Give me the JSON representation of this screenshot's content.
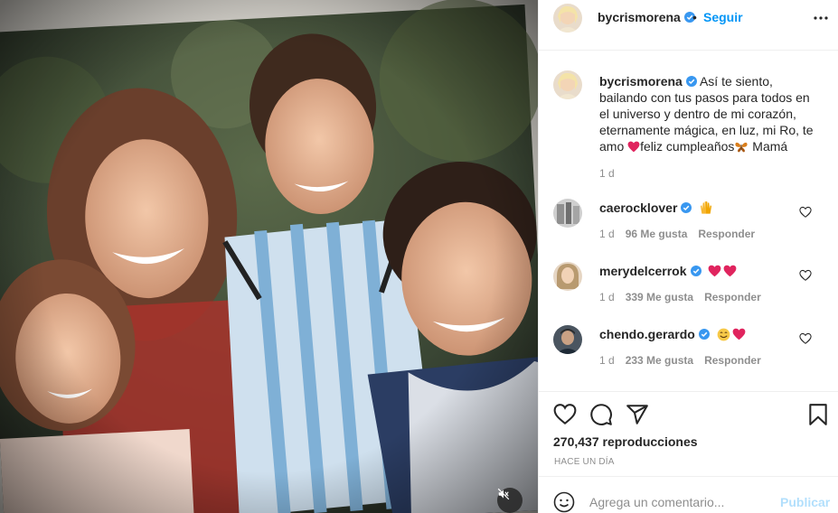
{
  "post": {
    "username": "bycrismorena",
    "separator": "•",
    "follow_label": "Seguir",
    "more_icon": "more-dots-icon",
    "caption": {
      "text": "Así te siento, bailando con tus pasos para todos en el universo y dentro de mi corazón, eternamente mágica, en luz, mi Ro, te amo ",
      "text_after_heart": "feliz cumpleaños",
      "text_end": " Mamá",
      "time": "1 d"
    },
    "comments": [
      {
        "username": "caerocklover",
        "emoji": "raised-hands",
        "time": "1 d",
        "likes": "96 Me gusta",
        "reply": "Responder"
      },
      {
        "username": "merydelcerrok",
        "emoji": "two-hearts",
        "time": "1 d",
        "likes": "339 Me gusta",
        "reply": "Responder"
      },
      {
        "username": "chendo.gerardo",
        "emoji": "smile-heart",
        "time": "1 d",
        "likes": "233 Me gusta",
        "reply": "Responder"
      }
    ],
    "views": "270,437 reproducciones",
    "posted_ago": "HACE UN DÍA",
    "add_comment_placeholder": "Agrega un comentario...",
    "publish_label": "Publicar"
  },
  "colors": {
    "link_blue": "#0095f6",
    "muted_gray": "#8e8e8e",
    "disabled_blue": "#b2dffc",
    "heart_red": "#ed4956"
  }
}
